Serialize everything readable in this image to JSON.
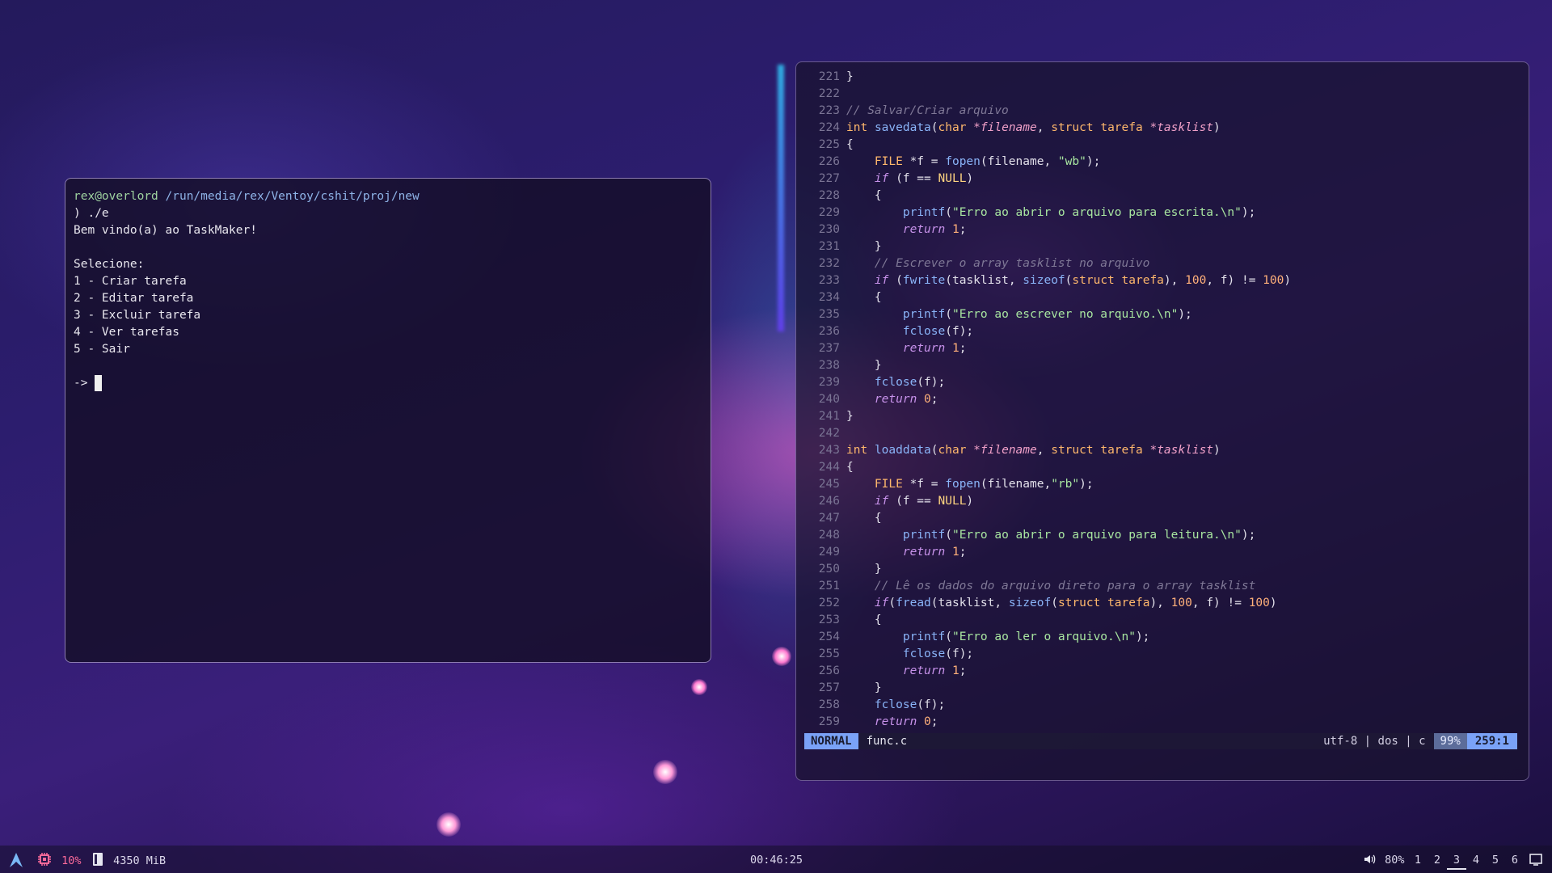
{
  "terminal": {
    "prompt_user": "rex@overlord",
    "prompt_path": "/run/media/rex/Ventoy/cshit/proj/new",
    "command": ") ./e",
    "lines": [
      "Bem vindo(a) ao TaskMaker!",
      "",
      "Selecione:",
      "1 - Criar tarefa",
      "2 - Editar tarefa",
      "3 - Excluir tarefa",
      "4 - Ver tarefas",
      "5 - Sair",
      ""
    ],
    "input_prompt": "-> "
  },
  "editor": {
    "line_numbers": [
      "221",
      "222",
      "223",
      "224",
      "225",
      "226",
      "227",
      "228",
      "229",
      "230",
      "231",
      "232",
      "233",
      "234",
      "235",
      "236",
      "237",
      "238",
      "239",
      "240",
      "241",
      "242",
      "243",
      "244",
      "245",
      "246",
      "247",
      "248",
      "249",
      "250",
      "251",
      "252",
      "253",
      "254",
      "255",
      "256",
      "257",
      "258",
      "259"
    ],
    "code": [
      "}",
      "",
      "// Salvar/Criar arquivo",
      "int savedata(char *filename, struct tarefa *tasklist)",
      "{",
      "    FILE *f = fopen(filename, \"wb\");",
      "    if (f == NULL)",
      "    {",
      "        printf(\"Erro ao abrir o arquivo para escrita.\\n\");",
      "        return 1;",
      "    }",
      "    // Escrever o array tasklist no arquivo",
      "    if (fwrite(tasklist, sizeof(struct tarefa), 100, f) != 100)",
      "    {",
      "        printf(\"Erro ao escrever no arquivo.\\n\");",
      "        fclose(f);",
      "        return 1;",
      "    }",
      "    fclose(f);",
      "    return 0;",
      "}",
      "",
      "int loaddata(char *filename, struct tarefa *tasklist)",
      "{",
      "    FILE *f = fopen(filename,\"rb\");",
      "    if (f == NULL)",
      "    {",
      "        printf(\"Erro ao abrir o arquivo para leitura.\\n\");",
      "        return 1;",
      "    }",
      "    // Lê os dados do arquivo direto para o array tasklist",
      "    if(fread(tasklist, sizeof(struct tarefa), 100, f) != 100)",
      "    {",
      "        printf(\"Erro ao ler o arquivo.\\n\");",
      "        fclose(f);",
      "        return 1;",
      "    }",
      "    fclose(f);",
      "    return 0;"
    ],
    "status": {
      "mode": "NORMAL",
      "filename": "func.c",
      "encoding": "utf-8 | dos | c",
      "percent": "99%",
      "position": "259:1"
    }
  },
  "taskbar": {
    "launcher_icon": "arch-icon",
    "cpu_icon": "cpu-icon",
    "cpu": "10%",
    "mem_icon": "memory-icon",
    "memory": "4350 MiB",
    "clock": "00:46:25",
    "volume_icon": "speaker-icon",
    "volume": "80%",
    "workspaces": [
      "1",
      "2",
      "3",
      "4",
      "5",
      "6"
    ],
    "active_workspace": "3",
    "layout_icon": "window-icon"
  },
  "colors": {
    "mode_bg": "#7aa2f7",
    "cpu_accent": "#ff6b9a"
  }
}
